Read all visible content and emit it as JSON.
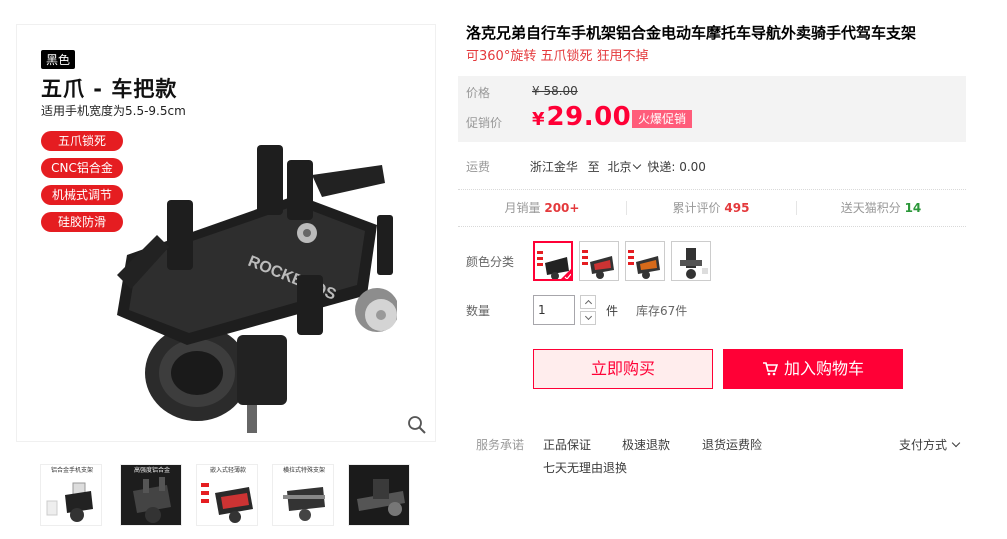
{
  "gallery": {
    "main_image": {
      "color_tag": "黑色",
      "headline": "五爪 - 车把款",
      "subline": "适用手机宽度为5.5-9.5cm",
      "features": [
        "五爪锁死",
        "CNC铝合金",
        "机械式调节",
        "硅胶防滑"
      ],
      "brand_mark": "ROCKBROS"
    },
    "thumbnails": [
      {
        "caption": "铝合金手机支架"
      },
      {
        "caption": "高强度铝合金"
      },
      {
        "caption": "嵌入式轻薄款"
      },
      {
        "caption": "横拉式特殊支架"
      },
      {
        "caption": ""
      }
    ]
  },
  "product": {
    "title": "洛克兄弟自行车手机架铝合金电动车摩托车导航外卖骑手代驾车支架",
    "subtitle": "可360°旋转 五爪锁死 狂甩不掉"
  },
  "price": {
    "label": "价格",
    "original": "¥ 58.00",
    "promo_label": "促销价",
    "currency": "¥",
    "sale": "29.00",
    "badge": "火爆促销"
  },
  "shipping": {
    "label": "运费",
    "origin": "浙江金华",
    "to": "至",
    "dest": "北京",
    "fee": "快递: 0.00"
  },
  "stats": {
    "monthly_label": "月销量",
    "monthly_value": "200+",
    "reviews_label": "累计评价",
    "reviews_value": "495",
    "points_label": "送天猫积分",
    "points_value": "14"
  },
  "options": {
    "color_label": "颜色分类",
    "selected_index": 0,
    "swatch_count": 4
  },
  "quantity": {
    "label": "数量",
    "value": "1",
    "unit": "件",
    "stock": "库存67件"
  },
  "actions": {
    "buy_now": "立即购买",
    "add_to_cart": "加入购物车"
  },
  "service": {
    "label": "服务承诺",
    "items": [
      "正品保证",
      "极速退款",
      "退货运费险",
      "七天无理由退换"
    ],
    "payment": "支付方式"
  },
  "colors": {
    "accent": "#ff0036",
    "price_bg": "#f3f3f3",
    "feature_red": "#e51d21"
  }
}
